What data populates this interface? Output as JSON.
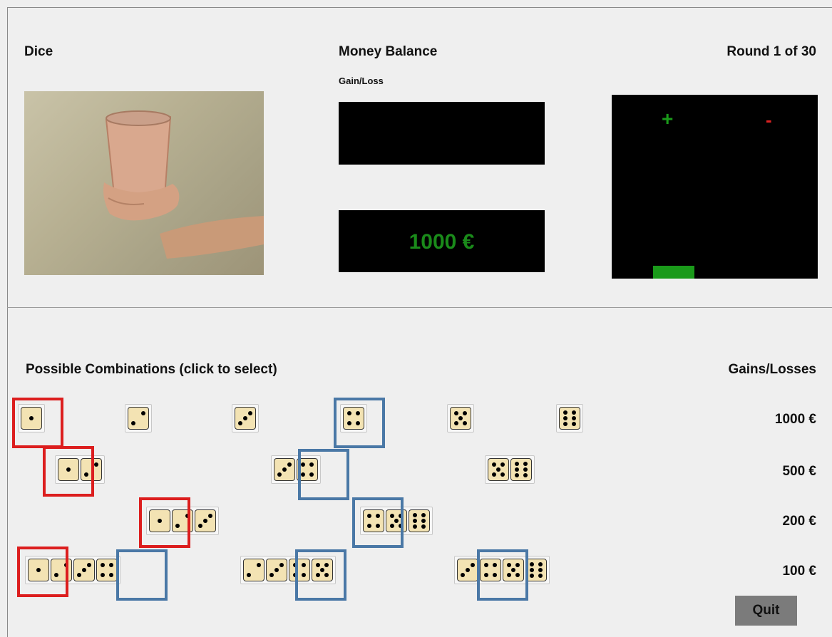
{
  "header": {
    "dice_label": "Dice",
    "money_balance_label": "Money Balance",
    "gain_loss_label": "Gain/Loss",
    "round_label": "Round 1 of 30"
  },
  "balance": {
    "gain_loss_value": "",
    "amount": "1000 €"
  },
  "gain_loss_indicator": {
    "plus": "+",
    "minus": "-",
    "plus_color": "#1a9a1a",
    "minus_color": "#dd2222"
  },
  "combinations": {
    "title": "Possible Combinations (click to select)",
    "gains_header": "Gains/Losses",
    "amounts": [
      "1000 €",
      "500 €",
      "200 €",
      "100 €"
    ],
    "rows": [
      [
        [
          1
        ],
        [
          2
        ],
        [
          3
        ],
        [
          4
        ],
        [
          5
        ],
        [
          6
        ]
      ],
      [
        [
          1,
          2
        ],
        [
          3,
          4
        ],
        [
          5,
          6
        ]
      ],
      [
        [
          1,
          2,
          3
        ],
        [
          4,
          5,
          6
        ]
      ],
      [
        [
          1,
          2,
          3,
          4
        ],
        [
          2,
          3,
          4,
          5
        ],
        [
          3,
          4,
          5,
          6
        ]
      ]
    ],
    "colors": {
      "die_face": "#f3e3b3",
      "red_highlight": "#dc1e1e",
      "blue_highlight": "#4a78a6"
    }
  },
  "quit_label": "Quit"
}
